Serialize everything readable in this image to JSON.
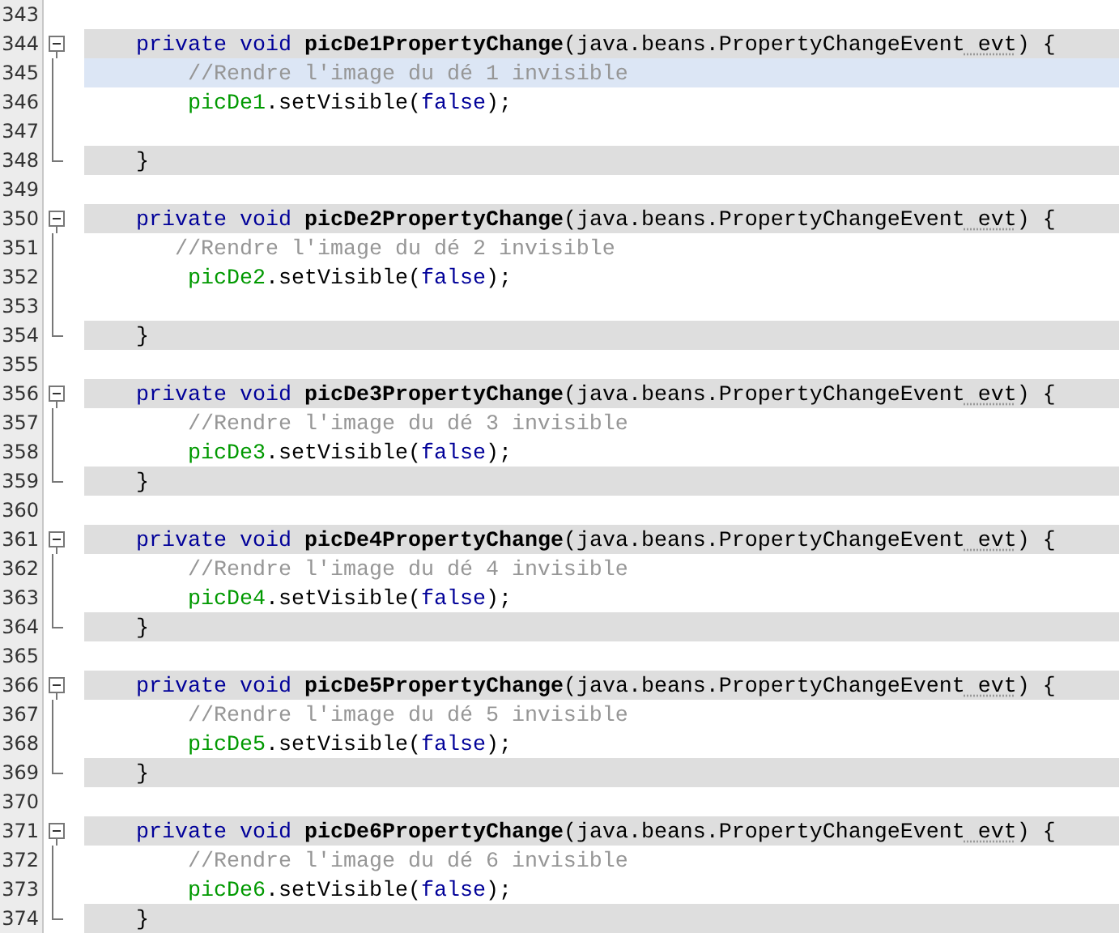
{
  "editor": {
    "lines": [
      {
        "number": "343",
        "kind": "plain",
        "guarded": false,
        "current": false
      },
      {
        "number": "344",
        "kind": "opener",
        "guarded": true,
        "current": false,
        "tokens": [
          {
            "kind": "keyword",
            "text": "    private"
          },
          {
            "kind": "keyword",
            "text": " void"
          },
          {
            "kind": "method",
            "text": " picDe1PropertyChange"
          },
          {
            "kind": "plain",
            "text": "(java.beans.PropertyChangeEvent"
          },
          {
            "kind": "warned",
            "text": " evt"
          },
          {
            "kind": "plain",
            "text": ") {"
          }
        ]
      },
      {
        "number": "345",
        "kind": "inner",
        "guarded": false,
        "current": true,
        "tokens": [
          {
            "kind": "comment",
            "text": "        //Rendre l'image du dé 1 invisible"
          }
        ]
      },
      {
        "number": "346",
        "kind": "inner",
        "guarded": false,
        "current": false,
        "tokens": [
          {
            "kind": "field",
            "text": "        picDe1"
          },
          {
            "kind": "plain",
            "text": ".setVisible("
          },
          {
            "kind": "keyword",
            "text": "false"
          },
          {
            "kind": "plain",
            "text": ");"
          }
        ]
      },
      {
        "number": "347",
        "kind": "inner",
        "guarded": false,
        "current": false
      },
      {
        "number": "348",
        "kind": "closer",
        "guarded": true,
        "current": false,
        "tokens": [
          {
            "kind": "plain",
            "text": "    }"
          }
        ]
      },
      {
        "number": "349",
        "kind": "plain",
        "guarded": false,
        "current": false
      },
      {
        "number": "350",
        "kind": "opener",
        "guarded": true,
        "current": false,
        "tokens": [
          {
            "kind": "keyword",
            "text": "    private"
          },
          {
            "kind": "keyword",
            "text": " void"
          },
          {
            "kind": "method",
            "text": " picDe2PropertyChange"
          },
          {
            "kind": "plain",
            "text": "(java.beans.PropertyChangeEvent"
          },
          {
            "kind": "warned",
            "text": " evt"
          },
          {
            "kind": "plain",
            "text": ") {"
          }
        ]
      },
      {
        "number": "351",
        "kind": "inner",
        "guarded": false,
        "current": false,
        "tokens": [
          {
            "kind": "comment",
            "text": "       //Rendre l'image du dé 2 invisible"
          }
        ]
      },
      {
        "number": "352",
        "kind": "inner",
        "guarded": false,
        "current": false,
        "tokens": [
          {
            "kind": "field",
            "text": "        picDe2"
          },
          {
            "kind": "plain",
            "text": ".setVisible("
          },
          {
            "kind": "keyword",
            "text": "false"
          },
          {
            "kind": "plain",
            "text": ");"
          }
        ]
      },
      {
        "number": "353",
        "kind": "inner",
        "guarded": false,
        "current": false
      },
      {
        "number": "354",
        "kind": "closer",
        "guarded": true,
        "current": false,
        "tokens": [
          {
            "kind": "plain",
            "text": "    }"
          }
        ]
      },
      {
        "number": "355",
        "kind": "plain",
        "guarded": false,
        "current": false
      },
      {
        "number": "356",
        "kind": "opener",
        "guarded": true,
        "current": false,
        "tokens": [
          {
            "kind": "keyword",
            "text": "    private"
          },
          {
            "kind": "keyword",
            "text": " void"
          },
          {
            "kind": "method",
            "text": " picDe3PropertyChange"
          },
          {
            "kind": "plain",
            "text": "(java.beans.PropertyChangeEvent"
          },
          {
            "kind": "warned",
            "text": " evt"
          },
          {
            "kind": "plain",
            "text": ") {"
          }
        ]
      },
      {
        "number": "357",
        "kind": "inner",
        "guarded": false,
        "current": false,
        "tokens": [
          {
            "kind": "comment",
            "text": "        //Rendre l'image du dé 3 invisible"
          }
        ]
      },
      {
        "number": "358",
        "kind": "inner",
        "guarded": false,
        "current": false,
        "tokens": [
          {
            "kind": "field",
            "text": "        picDe3"
          },
          {
            "kind": "plain",
            "text": ".setVisible("
          },
          {
            "kind": "keyword",
            "text": "false"
          },
          {
            "kind": "plain",
            "text": ");"
          }
        ]
      },
      {
        "number": "359",
        "kind": "closer",
        "guarded": true,
        "current": false,
        "tokens": [
          {
            "kind": "plain",
            "text": "    }"
          }
        ]
      },
      {
        "number": "360",
        "kind": "plain",
        "guarded": false,
        "current": false
      },
      {
        "number": "361",
        "kind": "opener",
        "guarded": true,
        "current": false,
        "tokens": [
          {
            "kind": "keyword",
            "text": "    private"
          },
          {
            "kind": "keyword",
            "text": " void"
          },
          {
            "kind": "method",
            "text": " picDe4PropertyChange"
          },
          {
            "kind": "plain",
            "text": "(java.beans.PropertyChangeEvent"
          },
          {
            "kind": "warned",
            "text": " evt"
          },
          {
            "kind": "plain",
            "text": ") {"
          }
        ]
      },
      {
        "number": "362",
        "kind": "inner",
        "guarded": false,
        "current": false,
        "tokens": [
          {
            "kind": "comment",
            "text": "        //Rendre l'image du dé 4 invisible"
          }
        ]
      },
      {
        "number": "363",
        "kind": "inner",
        "guarded": false,
        "current": false,
        "tokens": [
          {
            "kind": "field",
            "text": "        picDe4"
          },
          {
            "kind": "plain",
            "text": ".setVisible("
          },
          {
            "kind": "keyword",
            "text": "false"
          },
          {
            "kind": "plain",
            "text": ");"
          }
        ]
      },
      {
        "number": "364",
        "kind": "closer",
        "guarded": true,
        "current": false,
        "tokens": [
          {
            "kind": "plain",
            "text": "    }"
          }
        ]
      },
      {
        "number": "365",
        "kind": "plain",
        "guarded": false,
        "current": false
      },
      {
        "number": "366",
        "kind": "opener",
        "guarded": true,
        "current": false,
        "tokens": [
          {
            "kind": "keyword",
            "text": "    private"
          },
          {
            "kind": "keyword",
            "text": " void"
          },
          {
            "kind": "method",
            "text": " picDe5PropertyChange"
          },
          {
            "kind": "plain",
            "text": "(java.beans.PropertyChangeEvent"
          },
          {
            "kind": "warned",
            "text": " evt"
          },
          {
            "kind": "plain",
            "text": ") {"
          }
        ]
      },
      {
        "number": "367",
        "kind": "inner",
        "guarded": false,
        "current": false,
        "tokens": [
          {
            "kind": "comment",
            "text": "        //Rendre l'image du dé 5 invisible"
          }
        ]
      },
      {
        "number": "368",
        "kind": "inner",
        "guarded": false,
        "current": false,
        "tokens": [
          {
            "kind": "field",
            "text": "        picDe5"
          },
          {
            "kind": "plain",
            "text": ".setVisible("
          },
          {
            "kind": "keyword",
            "text": "false"
          },
          {
            "kind": "plain",
            "text": ");"
          }
        ]
      },
      {
        "number": "369",
        "kind": "closer",
        "guarded": true,
        "current": false,
        "tokens": [
          {
            "kind": "plain",
            "text": "    }"
          }
        ]
      },
      {
        "number": "370",
        "kind": "plain",
        "guarded": false,
        "current": false
      },
      {
        "number": "371",
        "kind": "opener",
        "guarded": true,
        "current": false,
        "tokens": [
          {
            "kind": "keyword",
            "text": "    private"
          },
          {
            "kind": "keyword",
            "text": " void"
          },
          {
            "kind": "method",
            "text": " picDe6PropertyChange"
          },
          {
            "kind": "plain",
            "text": "(java.beans.PropertyChangeEvent"
          },
          {
            "kind": "warned",
            "text": " evt"
          },
          {
            "kind": "plain",
            "text": ") {"
          }
        ]
      },
      {
        "number": "372",
        "kind": "inner",
        "guarded": false,
        "current": false,
        "tokens": [
          {
            "kind": "comment",
            "text": "        //Rendre l'image du dé 6 invisible"
          }
        ]
      },
      {
        "number": "373",
        "kind": "inner",
        "guarded": false,
        "current": false,
        "tokens": [
          {
            "kind": "field",
            "text": "        picDe6"
          },
          {
            "kind": "plain",
            "text": ".setVisible("
          },
          {
            "kind": "keyword",
            "text": "false"
          },
          {
            "kind": "plain",
            "text": ");"
          }
        ]
      },
      {
        "number": "374",
        "kind": "closer",
        "guarded": true,
        "current": false,
        "tokens": [
          {
            "kind": "plain",
            "text": "    }"
          }
        ]
      }
    ]
  }
}
